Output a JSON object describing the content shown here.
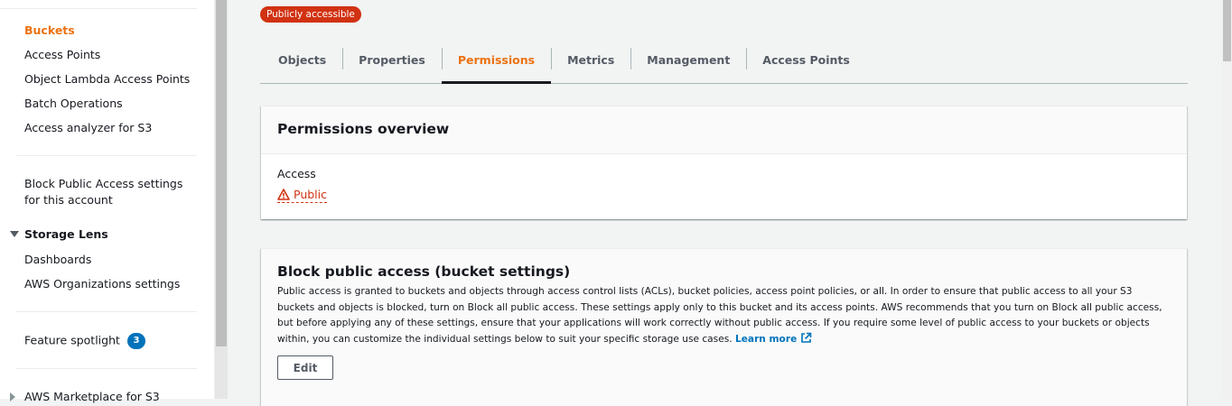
{
  "sidebar": {
    "items": {
      "buckets": "Buckets",
      "access_points": "Access Points",
      "object_lambda": "Object Lambda Access Points",
      "batch_operations": "Batch Operations",
      "access_analyzer": "Access analyzer for S3",
      "block_public_access": "Block Public Access settings for this account",
      "storage_lens": "Storage Lens",
      "dashboards": "Dashboards",
      "aws_org_settings": "AWS Organizations settings",
      "feature_spotlight": "Feature spotlight",
      "feature_spotlight_count": "3",
      "marketplace": "AWS Marketplace for S3"
    }
  },
  "main": {
    "public_badge": "Publicly accessible",
    "tabs": [
      "Objects",
      "Properties",
      "Permissions",
      "Metrics",
      "Management",
      "Access Points"
    ],
    "active_tab": "Permissions",
    "permissions_overview": {
      "title": "Permissions overview",
      "access_label": "Access",
      "access_value": "Public"
    },
    "block_public_access": {
      "title": "Block public access (bucket settings)",
      "description": "Public access is granted to buckets and objects through access control lists (ACLs), bucket policies, access point policies, or all. In order to ensure that public access to all your S3 buckets and objects is blocked, turn on Block all public access. These settings apply only to this bucket and its access points. AWS recommends that you turn on Block all public access, but before applying any of these settings, ensure that your applications will work correctly without public access. If you require some level of public access to your buckets or objects within, you can customize the individual settings below to suit your specific storage use cases.",
      "learn_more": "Learn more",
      "edit_label": "Edit"
    }
  },
  "colors": {
    "accent_orange": "#ec7211",
    "danger_red": "#d13212",
    "link_blue": "#0073bb"
  },
  "icons": {
    "warning": "warning-icon",
    "external_link": "external-link-icon"
  }
}
